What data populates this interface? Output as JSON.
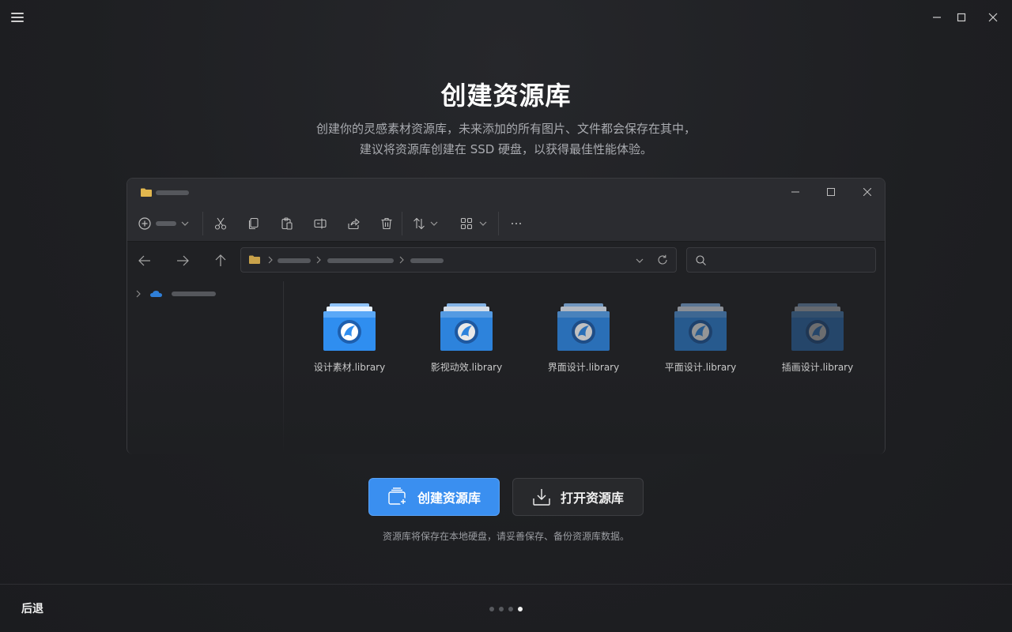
{
  "header": {
    "title": "创建资源库",
    "subtitle_line1": "创建你的灵感素材资源库，未来添加的所有图片、文件都会保存在其中，",
    "subtitle_line2": "建议将资源库创建在 SSD 硬盘，以获得最佳性能体验。"
  },
  "files": [
    {
      "name": "设计素材.library",
      "color": "#2f8ef0",
      "opacity": 1.0
    },
    {
      "name": "影视动效.library",
      "color": "#2f8ef0",
      "opacity": 0.9
    },
    {
      "name": "界面设计.library",
      "color": "#2f8ef0",
      "opacity": 0.72
    },
    {
      "name": "平面设计.library",
      "color": "#2f8ef0",
      "opacity": 0.52
    },
    {
      "name": "插画设计.library",
      "color": "#2f8ef0",
      "opacity": 0.34
    }
  ],
  "actions": {
    "create_label": "创建资源库",
    "open_label": "打开资源库",
    "note": "资源库将保存在本地硬盘，请妥善保存、备份资源库数据。"
  },
  "footer": {
    "back_label": "后退",
    "step_total": 4,
    "step_current": 4
  },
  "colors": {
    "accent": "#3a8ff0",
    "background": "#1f2023"
  }
}
